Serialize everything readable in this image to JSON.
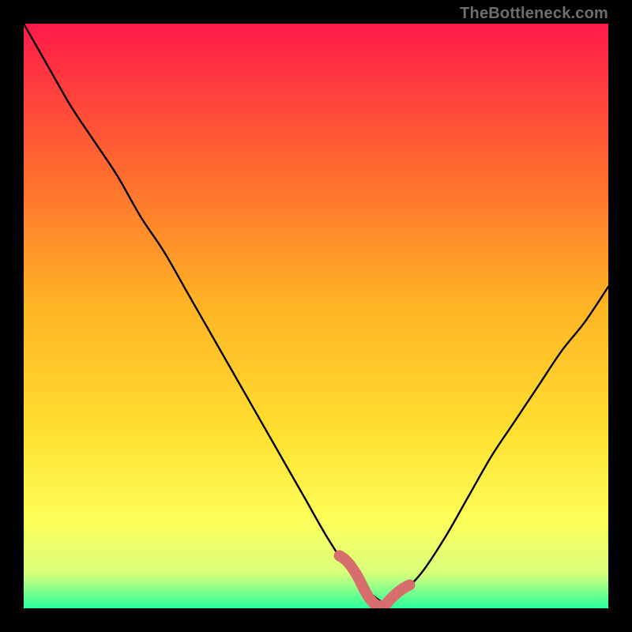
{
  "watermark": "TheBottleneck.com",
  "colors": {
    "background": "#000000",
    "watermark": "#6e6e6e",
    "curve_main": "#000000",
    "curve_highlight": "#d76d6d",
    "grad_top": "#ff1a4a",
    "grad_mid1": "#ff6a2f",
    "grad_mid2": "#ffb325",
    "grad_mid3": "#ffe030",
    "grad_mid4": "#fdff5a",
    "grad_mid5": "#d8ff7a",
    "grad_bottom": "#29ff9d"
  },
  "chart_data": {
    "type": "line",
    "title": "",
    "xlabel": "",
    "ylabel": "",
    "xlim": [
      0,
      100
    ],
    "ylim": [
      0,
      100
    ],
    "legend": false,
    "grid": false,
    "series": [
      {
        "name": "bottleneck-curve",
        "x": [
          0,
          4,
          8,
          12,
          16,
          20,
          24,
          28,
          32,
          36,
          40,
          44,
          48,
          52,
          56,
          60,
          62,
          64,
          68,
          72,
          76,
          80,
          84,
          88,
          92,
          96,
          100
        ],
        "values": [
          100,
          93,
          86,
          80,
          74,
          67,
          61,
          54,
          47,
          40,
          33,
          26,
          19,
          12,
          6,
          2,
          1,
          2,
          6,
          12,
          19,
          26,
          32,
          38,
          44,
          49,
          55
        ]
      }
    ],
    "highlight_segment": {
      "x_start": 54,
      "x_end": 66,
      "note": "flat valley bottom drawn thicker in muted red"
    }
  }
}
